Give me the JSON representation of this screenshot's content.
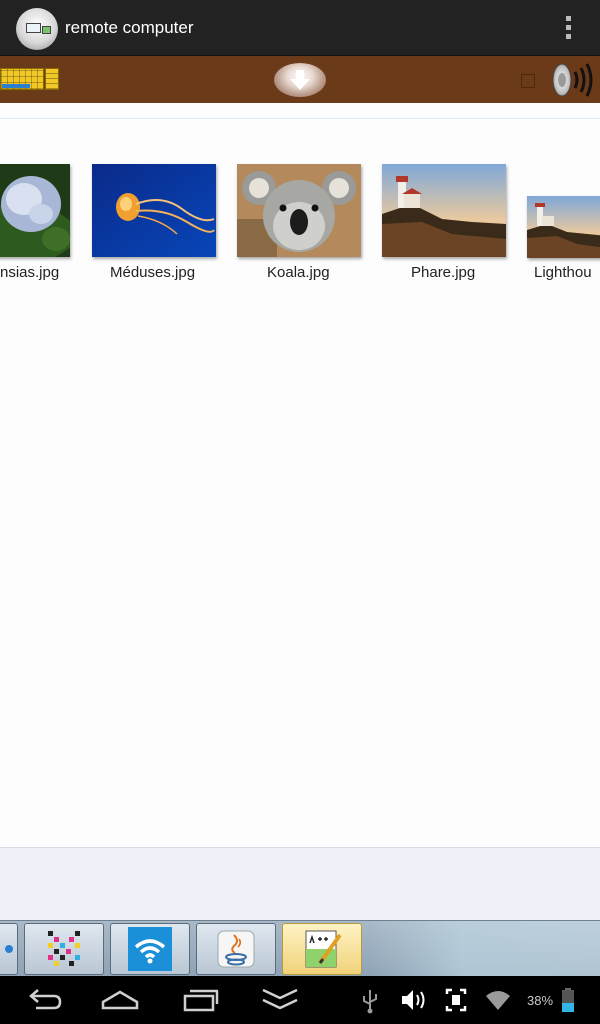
{
  "action_bar": {
    "title": "remote computer",
    "app_icon": "remote-computer-icon",
    "menu_icon": "overflow-menu-icon"
  },
  "toolbar": {
    "keyboard_icon": "keyboard-icon",
    "download_icon": "download-arrow-icon",
    "speaker_icon": "speaker-icon",
    "background": "#6a3a19"
  },
  "explorer": {
    "files": [
      {
        "name": "nsias.jpg",
        "thumb": "hydrangea"
      },
      {
        "name": "Méduses.jpg",
        "thumb": "jellyfish"
      },
      {
        "name": "Koala.jpg",
        "thumb": "koala"
      },
      {
        "name": "Phare.jpg",
        "thumb": "lighthouse"
      },
      {
        "name": "Lighthou",
        "thumb": "lighthouse"
      }
    ]
  },
  "taskbar": {
    "buttons": [
      {
        "icon": "app-icon"
      },
      {
        "icon": "pixel-grid-icon"
      },
      {
        "icon": "wifi-icon"
      },
      {
        "icon": "java-icon"
      },
      {
        "icon": "notepad-plus-plus-icon"
      }
    ]
  },
  "nav_bar": {
    "icons": [
      "back-icon",
      "home-icon",
      "recent-apps-icon",
      "hide-keyboard-icon",
      "usb-icon",
      "volume-icon",
      "screenshot-icon",
      "wifi-signal-icon",
      "battery-icon"
    ],
    "battery": "38%",
    "accent": "#33b5e5"
  }
}
